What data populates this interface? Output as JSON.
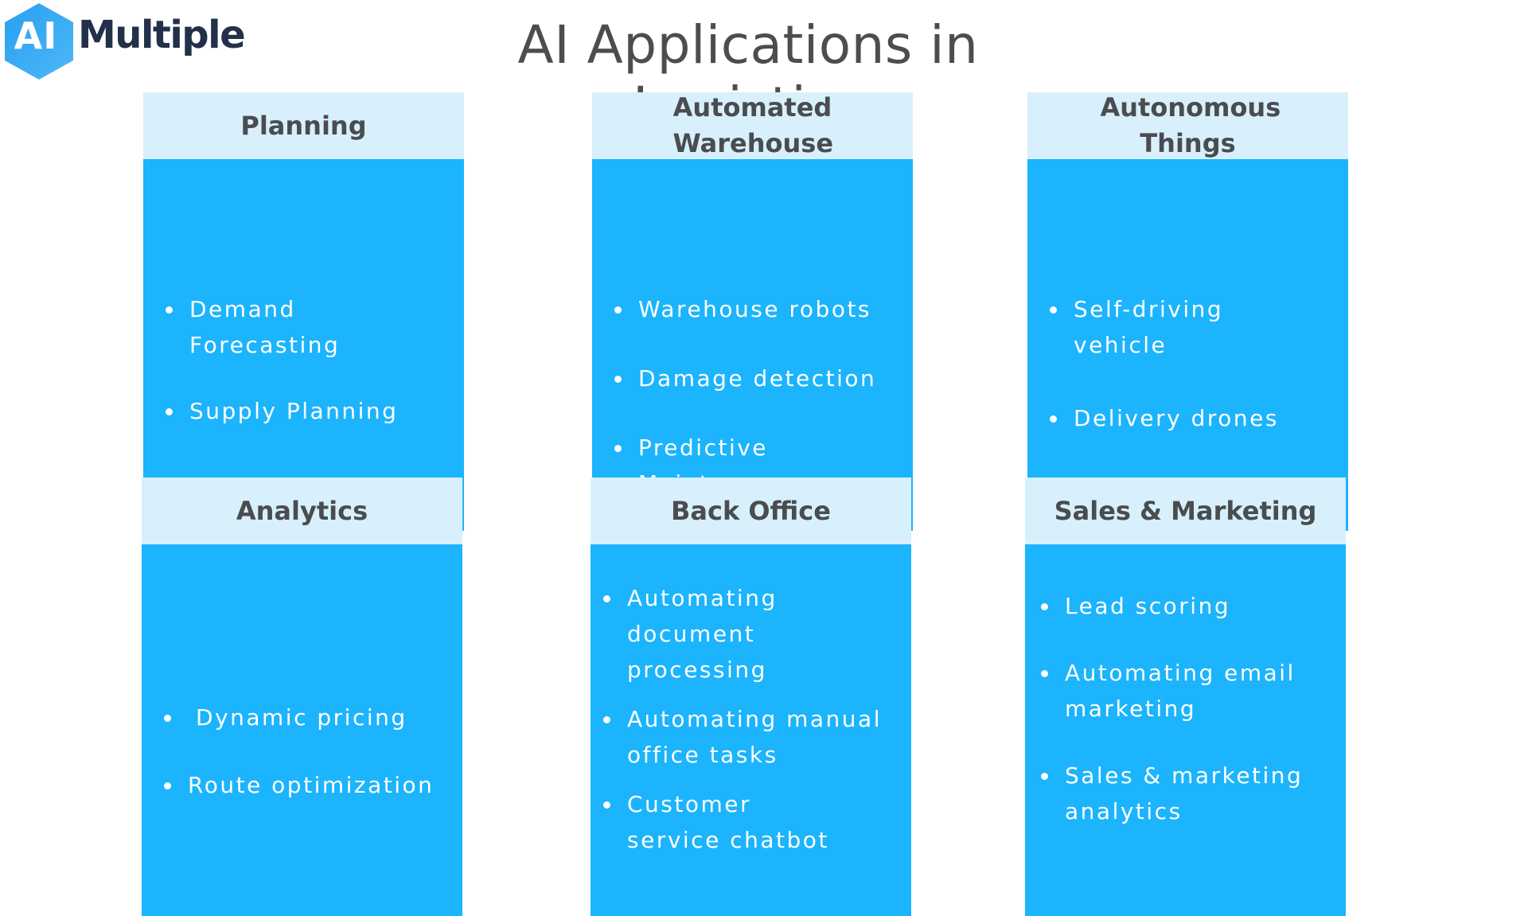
{
  "logo": {
    "ai": "AI",
    "name": "Multiple",
    "hex_color": "#2aa3f0"
  },
  "title": "AI Applications in Logistics",
  "colors": {
    "header_bg": "#d7f0fc",
    "body_bg": "#1cb4fc",
    "header_text": "#4a4c4f",
    "item_text": "#ffffff"
  },
  "cards": [
    {
      "title": "Planning",
      "items": [
        "Demand Forecasting",
        "Supply Planning"
      ]
    },
    {
      "title": "Automated Warehouse",
      "items": [
        "Warehouse robots",
        "Damage detection",
        "Predictive Maintenance"
      ]
    },
    {
      "title": "Autonomous Things",
      "items": [
        "Self-driving vehicle",
        "Delivery drones"
      ]
    },
    {
      "title": "Analytics",
      "items": [
        "Dynamic pricing",
        "Route optimization"
      ]
    },
    {
      "title": "Back Office",
      "items": [
        "Automating document processing",
        "Automating manual office tasks",
        "Customer service chatbot"
      ]
    },
    {
      "title": "Sales & Marketing",
      "items": [
        "Lead scoring",
        "Automating email marketing",
        "Sales & marketing analytics"
      ]
    }
  ]
}
